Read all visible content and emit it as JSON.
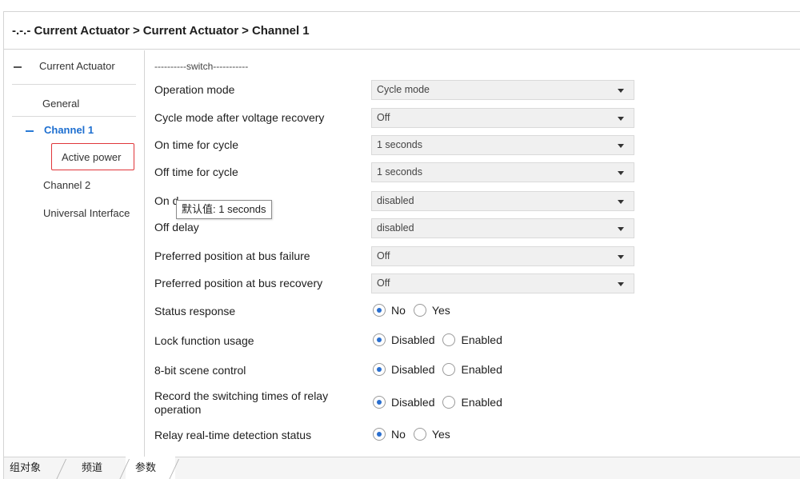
{
  "header": {
    "breadcrumb": [
      "-.-.- Current Actuator",
      "Current Actuator",
      "Channel 1"
    ],
    "separator": ">"
  },
  "sidebar": {
    "root": "Current Actuator",
    "items": [
      {
        "label": "General"
      },
      {
        "label": "Channel 1",
        "expanded": true,
        "active": true
      },
      {
        "label": "Active power",
        "highlighted": true
      },
      {
        "label": "Channel 2"
      },
      {
        "label": "Universal Interface"
      }
    ]
  },
  "main": {
    "section_title": "----------switch-----------",
    "selects": [
      {
        "label": "Operation mode",
        "value": "Cycle mode"
      },
      {
        "label": "Cycle mode after voltage recovery",
        "value": "Off"
      },
      {
        "label": "On time for cycle",
        "value": "1 seconds"
      },
      {
        "label": "Off time for cycle",
        "value": "1 seconds"
      },
      {
        "label": "On d",
        "value": "disabled"
      },
      {
        "label": "Off delay",
        "value": "disabled"
      },
      {
        "label": "Preferred position at bus failure",
        "value": "Off"
      },
      {
        "label": "Preferred position at bus recovery",
        "value": "Off"
      }
    ],
    "radios": [
      {
        "label": "Status response",
        "options": [
          "No",
          "Yes"
        ],
        "selected": "No"
      },
      {
        "label": "Lock function usage",
        "options": [
          "Disabled",
          "Enabled"
        ],
        "selected": "Disabled"
      },
      {
        "label": "8-bit scene control",
        "options": [
          "Disabled",
          "Enabled"
        ],
        "selected": "Disabled"
      },
      {
        "label_line1": "Record the switching times of relay",
        "label_line2": "operation",
        "options": [
          "Disabled",
          "Enabled"
        ],
        "selected": "Disabled"
      },
      {
        "label": "Relay real-time detection status",
        "options": [
          "No",
          "Yes"
        ],
        "selected": "No"
      }
    ]
  },
  "tooltip": {
    "text": "默认值: 1 seconds"
  },
  "bottom_tabs": [
    {
      "label": "组对象"
    },
    {
      "label": "频道"
    },
    {
      "label": "参数",
      "active": true
    }
  ],
  "colors": {
    "accent": "#1e6fd0",
    "highlight_border": "#e0363a",
    "radio_dot": "#2a6fcf"
  }
}
